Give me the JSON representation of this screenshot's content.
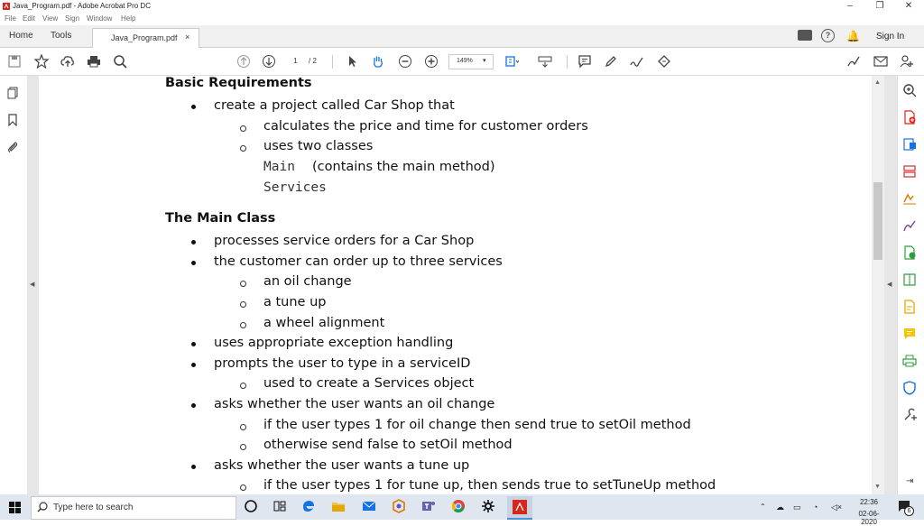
{
  "window": {
    "title": "Java_Program.pdf - Adobe Acrobat Pro DC"
  },
  "menu": [
    "File",
    "Edit",
    "View",
    "Sign",
    "Window",
    "Help"
  ],
  "tabs": {
    "home": "Home",
    "tools": "Tools",
    "document": "Java_Program.pdf",
    "close": "×"
  },
  "header": {
    "sign_in": "Sign In"
  },
  "toolbar": {
    "page_current": "1",
    "page_total": "/ 2",
    "zoom": "149%"
  },
  "document": {
    "sections": [
      {
        "heading": "Basic Requirements",
        "items": [
          {
            "level": 1,
            "text": "create a project called Car Shop that"
          },
          {
            "level": 2,
            "text": "calculates the price and time for customer orders"
          },
          {
            "level": 2,
            "text": "uses two classes"
          },
          {
            "level": 3,
            "code": "Main",
            "text": "(contains the main method)"
          },
          {
            "level": 3,
            "code": "Services",
            "text": ""
          }
        ]
      },
      {
        "heading": "The Main Class",
        "items": [
          {
            "level": 1,
            "text": "processes service orders for a Car Shop"
          },
          {
            "level": 1,
            "text": "the customer can order up to three services"
          },
          {
            "level": 2,
            "text": "an oil change"
          },
          {
            "level": 2,
            "text": "a tune up"
          },
          {
            "level": 2,
            "text": "a wheel alignment"
          },
          {
            "level": 1,
            "text": "uses appropriate exception handling"
          },
          {
            "level": 1,
            "text": "prompts the user to type in a serviceID"
          },
          {
            "level": 2,
            "text": "used to create a Services object"
          },
          {
            "level": 1,
            "text": "asks whether the user wants an oil change"
          },
          {
            "level": 2,
            "text": "if the user types 1 for oil change then send true to setOil method"
          },
          {
            "level": 2,
            "text": "otherwise send false to setOil method"
          },
          {
            "level": 1,
            "text": "asks whether the user wants a tune up"
          },
          {
            "level": 2,
            "text": "if the user types 1 for tune up, then sends true to setTuneUp method"
          }
        ]
      }
    ]
  },
  "taskbar": {
    "search_placeholder": "Type here to search",
    "time": "22:36",
    "date": "02-06-2020",
    "notification_count": "6"
  },
  "colors": {
    "acrobat_red": "#d9261c",
    "accent_blue": "#1473e6",
    "taskbar_bg": "#dfe6ef"
  }
}
